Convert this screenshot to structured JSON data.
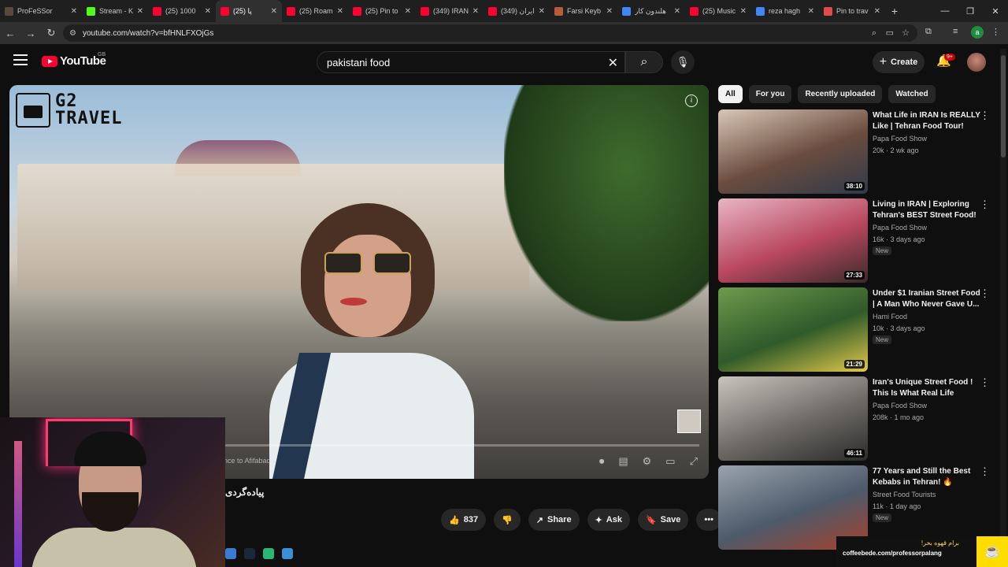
{
  "browser": {
    "tabs": [
      {
        "label": "ProFeSSor",
        "color": "#5a4a3a"
      },
      {
        "label": "Stream - K",
        "color": "#53fc18"
      },
      {
        "label": "(25) 1000",
        "color": "#ff0033"
      },
      {
        "label": "(25) پا",
        "color": "#ff0033",
        "active": true
      },
      {
        "label": "(25) Roam",
        "color": "#ff0033"
      },
      {
        "label": "(25) Pin to",
        "color": "#ff0033"
      },
      {
        "label": "(349) IRAN",
        "color": "#ff0033"
      },
      {
        "label": "(349) ایران",
        "color": "#ff0033"
      },
      {
        "label": "Farsi Keyb",
        "color": "#b85c38"
      },
      {
        "label": "هلندون کار",
        "color": "#4285f4"
      },
      {
        "label": "(25) Music",
        "color": "#ff0033"
      },
      {
        "label": "reza hagh",
        "color": "#4285f4"
      },
      {
        "label": "Pin to trav",
        "color": "#e04a4a"
      }
    ],
    "url": "youtube.com/watch?v=bfHNLFXOjGs",
    "profile_letter": "a"
  },
  "youtube": {
    "logo_text": "YouTube",
    "region": "GB",
    "search_query": "pakistani food",
    "create_label": "Create",
    "notif_badge": "9+"
  },
  "video": {
    "overlay_logo_line1": "G2",
    "overlay_logo_line2": "TRAVEL",
    "chapter_text": "nce to Afifabad",
    "title": "پیاده‌گردی",
    "likes": "837",
    "share_label": "Share",
    "ask_label": "Ask",
    "save_label": "Save"
  },
  "filters": [
    {
      "label": "All",
      "active": true
    },
    {
      "label": "For you",
      "active": false
    },
    {
      "label": "Recently uploaded",
      "active": false
    },
    {
      "label": "Watched",
      "active": false
    }
  ],
  "recommendations": [
    {
      "title": "What Life in IRAN Is REALLY Like | Tehran Food Tour!",
      "channel": "Papa Food Show",
      "meta": "20k · 2 wk ago",
      "duration": "38:10",
      "new": "",
      "thumb": [
        "#d9c7b6",
        "#6a4c3f",
        "#2f3a4a"
      ]
    },
    {
      "title": "Living in IRAN | Exploring Tehran's BEST Street Food!",
      "channel": "Papa Food Show",
      "meta": "16k · 3 days ago",
      "duration": "27:33",
      "new": "New",
      "thumb": [
        "#e8b6c4",
        "#b9475f",
        "#3a2b2b"
      ]
    },
    {
      "title": "Under $1 Iranian Street Food | A Man Who Never Gave U...",
      "channel": "Hami Food",
      "meta": "10k · 3 days ago",
      "duration": "21:29",
      "new": "New",
      "thumb": [
        "#6f9a4d",
        "#2f5a2a",
        "#e2c84a"
      ]
    },
    {
      "title": "Iran's Unique Street Food ! This Is What Real Life Look...",
      "channel": "Papa Food Show",
      "meta": "208k · 1 mo ago",
      "duration": "46:11",
      "new": "",
      "thumb": [
        "#c9c4bc",
        "#6d6a66",
        "#2b2b2b"
      ]
    },
    {
      "title": "77 Years and Still the Best Kebabs in Tehran! 🔥",
      "channel": "Street Food Tourists",
      "meta": "11k · 1 day ago",
      "duration": "",
      "new": "New",
      "thumb": [
        "#9aa3ad",
        "#4d5a6a",
        "#a6412e"
      ]
    }
  ],
  "coffee": {
    "fa_text": "برام قهوه بخر!",
    "url": "coffeebede.com/professorpalang"
  }
}
